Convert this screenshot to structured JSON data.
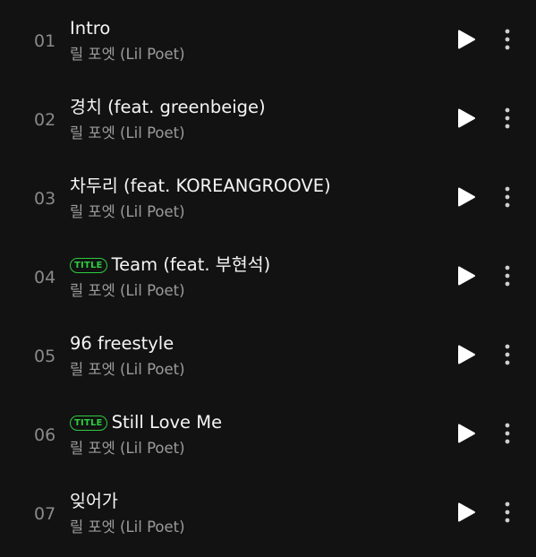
{
  "tracks": [
    {
      "number": "01",
      "title": "Intro",
      "artist": "릴 포엣 (Lil Poet)",
      "is_title": false
    },
    {
      "number": "02",
      "title": "경치 (feat. greenbeige)",
      "artist": "릴 포엣 (Lil Poet)",
      "is_title": false
    },
    {
      "number": "03",
      "title": "차두리 (feat. KOREANGROOVE)",
      "artist": "릴 포엣 (Lil Poet)",
      "is_title": false
    },
    {
      "number": "04",
      "title": "Team (feat. 부현석)",
      "artist": "릴 포엣 (Lil Poet)",
      "is_title": true
    },
    {
      "number": "05",
      "title": "96 freestyle",
      "artist": "릴 포엣 (Lil Poet)",
      "is_title": false
    },
    {
      "number": "06",
      "title": "Still Love Me",
      "artist": "릴 포엣 (Lil Poet)",
      "is_title": true
    },
    {
      "number": "07",
      "title": "잊어가",
      "artist": "릴 포엣 (Lil Poet)",
      "is_title": false
    }
  ],
  "badge_label": "TITLE",
  "icons": {
    "play": "play-icon",
    "more": "more-vertical-icon"
  },
  "colors": {
    "background": "#121212",
    "badge": "#2ecc40",
    "title_text": "#f5f5f5",
    "secondary_text": "#9b9b9b"
  }
}
